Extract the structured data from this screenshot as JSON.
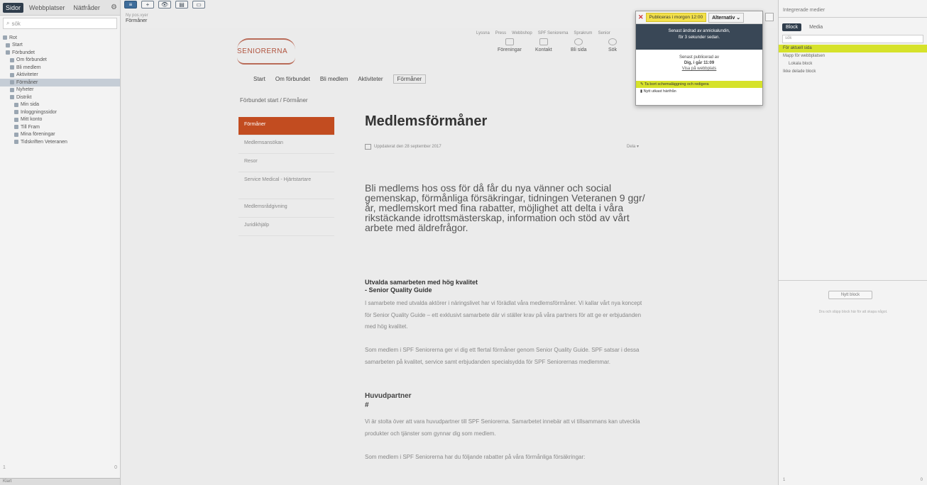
{
  "left_panel": {
    "tabs": [
      "Sidor",
      "Webbplatser",
      "Nätfråder"
    ],
    "search_placeholder": "sök",
    "tree": [
      "Rot",
      "Start",
      "Förbundet",
      "Om förbundet",
      "Bli medlem",
      "Aktiviteter",
      "Förmåner",
      "Nyheter",
      "Distrikt",
      "Min sida",
      "Inloggningssidor",
      "Mitt konto",
      "Till Fram",
      "Mina föreningar",
      "Tidskriften Veteranen"
    ],
    "pager_left": "1",
    "pager_right": "0",
    "status": "Klart"
  },
  "toolbar": {
    "buttons": [
      "≡",
      "+",
      "👁",
      "▤",
      "▭"
    ],
    "crumb": "Ny pos.vyer",
    "page_name": "Förmåner"
  },
  "preview": {
    "logo_text": "SENIORERNA",
    "util_links": [
      "Lyssna",
      "Press",
      "Webbshop",
      "SPF Seniorerna",
      "Sprakrum",
      "Senior"
    ],
    "quick_links": [
      "Föreningar",
      "Kontakt",
      "Bli sida",
      "Sök"
    ],
    "nav": [
      "Start",
      "Om förbundet",
      "Bli medlem",
      "Aktiviteter",
      "Förmåner"
    ],
    "breadcrumb": "Förbundet start  /  Förmåner",
    "side_nav": [
      "Förmåner",
      "Medlemsansökan",
      "Resor",
      "Service Medical - Hjärtstartare",
      "Medlemsrådgivning",
      "Juridikhjälp"
    ],
    "title": "Medlemsförmåner",
    "meta_date": "Uppdaterat den 28 september 2017",
    "share": "Dela ▾",
    "intro": "Bli medlems hos oss för då får du nya vänner och social gemenskap, förmånliga försäkringar, tidningen Veteranen 9 ggr/år, medlemskort med fina rabatter, möjlighet att delta i våra rikstäckande idrottsmästerskap, information och stöd av vårt arbete med äldrefrågor.",
    "sub1_line1": "Utvalda samarbeten med hög kvalitet",
    "sub1_line2": "- Senior Quality Guide",
    "para1": "I samarbete med utvalda aktörer i näringslivet har vi förädlat våra medlemsförmåner. Vi kallar vårt nya koncept för Senior Quality Guide – ett exklusivt samarbete där vi ställer krav på våra partners för att ge er erbjudanden med hög kvalitet.",
    "para2": "Som medlem i SPF Seniorerna ger vi dig ett flertal förmåner genom Senior Quality Guide. SPF satsar i dessa samarbeten på kvalitet, service samt erbjudanden specialsydda för SPF Seniorernas medlemmar.",
    "sub2_line1": "Huvudpartner",
    "sub2_line2": "#",
    "para3": "Vi är stolta över att vara huvudpartner till SPF Seniorerna. Samarbetet innebär att vi tillsammans kan utveckla produkter och tjänster som gynnar dig som medlem.",
    "para4": "Som medlem i SPF Seniorerna har du följande rabatter på våra förmånliga försäkringar:"
  },
  "publish_popup": {
    "close": "✕",
    "publish_label": "Publiceras i morgon 12:00",
    "alternatives_label": "Alternativ ⌄",
    "last_changed_line1": "Senast ändrad av annickalundin,",
    "last_changed_line2": "för 3 sekunder sedan.",
    "last_published_line1": "Senast publicerad av",
    "last_published_line2": "Dig, i går 11:09",
    "view_on_site": "Visa på webbplats",
    "option_schedule": "Ta bort schemaläggning och redigera",
    "option_new_draft": "Nytt utkast härifrån"
  },
  "right_panel": {
    "title": "Integrerade medier",
    "tabs": [
      "Block",
      "Media"
    ],
    "search_placeholder": "sök",
    "items": [
      "För aktuell sida",
      "Mapp för webbplatsen",
      "Lokala block",
      "Ikke delade block"
    ],
    "drop_button": "Nytt block",
    "hint": "Dra och släpp block här för att skapa något.",
    "pager_left": "1",
    "pager_right": "0"
  }
}
